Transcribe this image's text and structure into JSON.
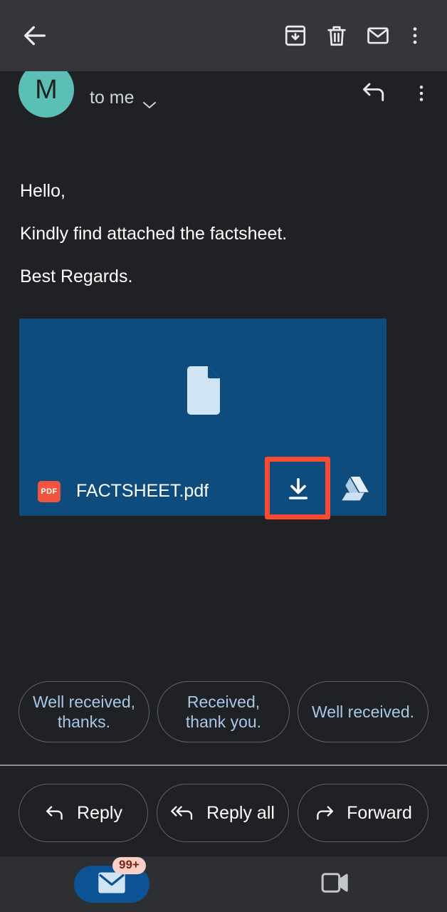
{
  "app_bar": {
    "back_icon": "back-arrow-icon",
    "actions": [
      {
        "name": "archive-icon",
        "label": "Archive"
      },
      {
        "name": "delete-icon",
        "label": "Delete"
      },
      {
        "name": "mark-unread-icon",
        "label": "Mark as unread"
      },
      {
        "name": "more-options-icon",
        "label": "More options"
      }
    ]
  },
  "message_header": {
    "avatar_letter": "M",
    "avatar_color": "#5bbfb5",
    "recipients": "to me",
    "expand_icon": "chevron-down-icon",
    "reply_icon": "reply-icon",
    "kebab_icon": "more-options-icon"
  },
  "body": {
    "lines": [
      "Hello,",
      "Kindly find attached the factsheet.",
      "Best Regards."
    ]
  },
  "attachment": {
    "filename": "FACTSHEET.pdf",
    "file_type_badge": "PDF",
    "card_color": "#0d4c7c",
    "badge_color": "#f05540",
    "preview_icon": "document-icon",
    "download_icon": "download-icon",
    "drive_icon": "google-drive-icon",
    "highlight_color": "#fb4a32"
  },
  "smart_replies": [
    "Well received, thanks.",
    "Received, thank you.",
    "Well received."
  ],
  "smart_replies_split": [
    {
      "l1": "Well received,",
      "l2": "thanks."
    },
    {
      "l1": "Received,",
      "l2": "thank you."
    },
    {
      "l1": "Well received.",
      "l2": ""
    }
  ],
  "actions": [
    {
      "label": "Reply",
      "icon": "reply-icon"
    },
    {
      "label": "Reply all",
      "icon": "reply-all-icon"
    },
    {
      "label": "Forward",
      "icon": "forward-icon"
    }
  ],
  "bottom_nav": {
    "mail": {
      "icon": "mail-icon",
      "badge": "99+",
      "active": true,
      "pill_color": "#0b5394"
    },
    "meet": {
      "icon": "video-camera-icon",
      "active": false
    }
  }
}
